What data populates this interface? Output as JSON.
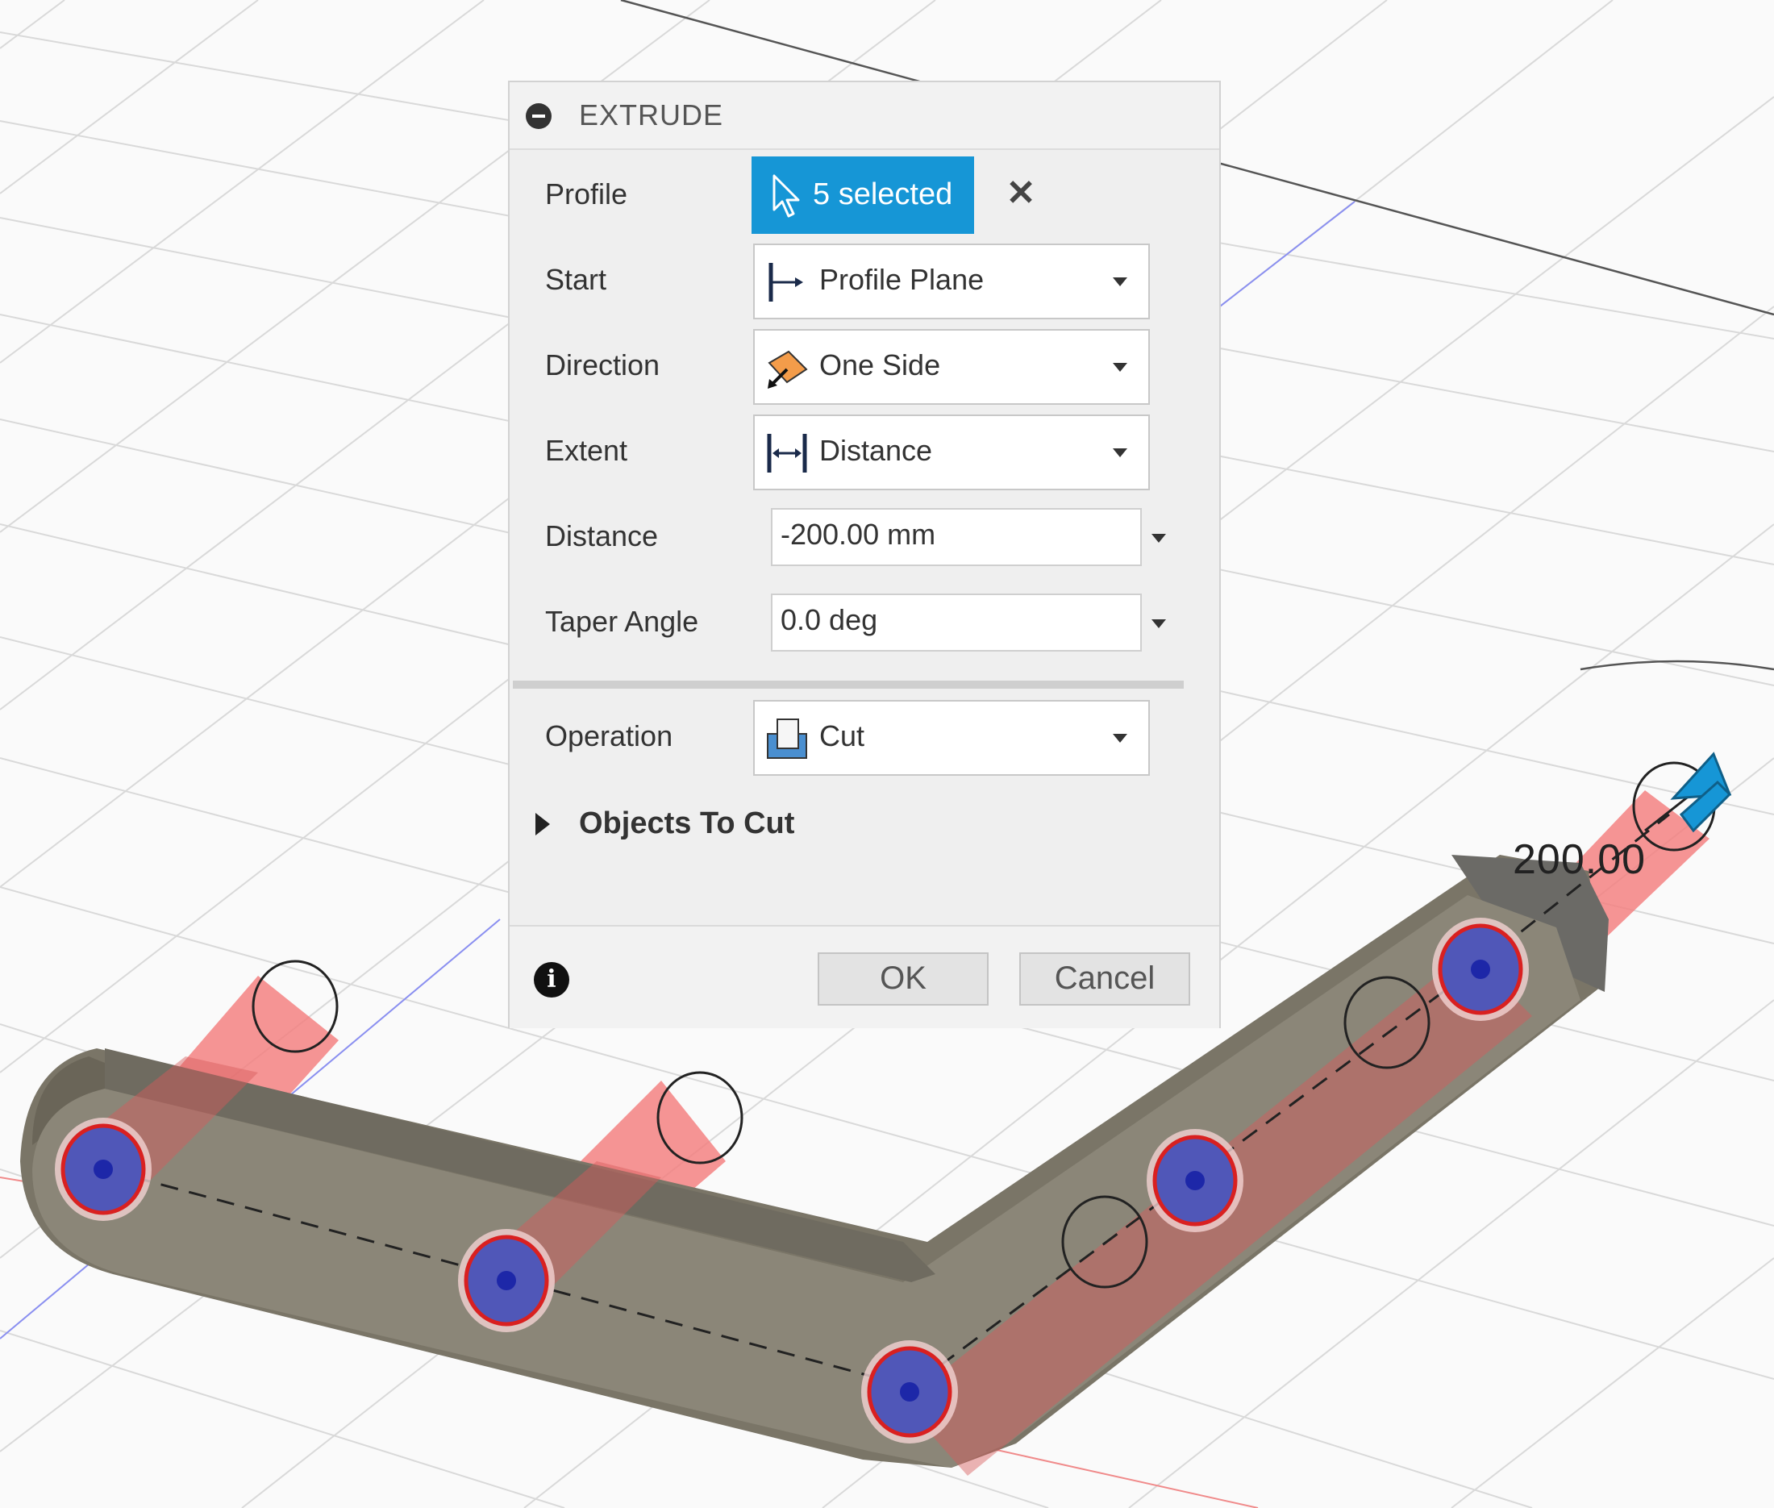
{
  "dialog": {
    "title": "EXTRUDE",
    "rows": {
      "profile": {
        "label": "Profile",
        "selection": "5 selected"
      },
      "start": {
        "label": "Start",
        "value": "Profile Plane"
      },
      "direction": {
        "label": "Direction",
        "value": "One Side"
      },
      "extent": {
        "label": "Extent",
        "value": "Distance"
      },
      "distance": {
        "label": "Distance",
        "value": "-200.00 mm"
      },
      "taper": {
        "label": "Taper Angle",
        "value": "0.0 deg"
      },
      "operation": {
        "label": "Operation",
        "value": "Cut"
      }
    },
    "section": {
      "title": "Objects To Cut"
    },
    "ok_label": "OK",
    "cancel_label": "Cancel"
  },
  "viewport": {
    "dimension_label": "200.00"
  },
  "colors": {
    "selection_blue": "#1696d6",
    "extrude_preview": "#f47b7b",
    "body": "#8b8678",
    "profile_hole": "#5057b8"
  },
  "icons": [
    "collapse-icon",
    "cursor-arrow-icon",
    "close-icon",
    "profile-plane-icon",
    "one-side-icon",
    "distance-icon",
    "cut-icon",
    "expand-triangle-icon",
    "info-icon",
    "drag-arrow-icon"
  ]
}
